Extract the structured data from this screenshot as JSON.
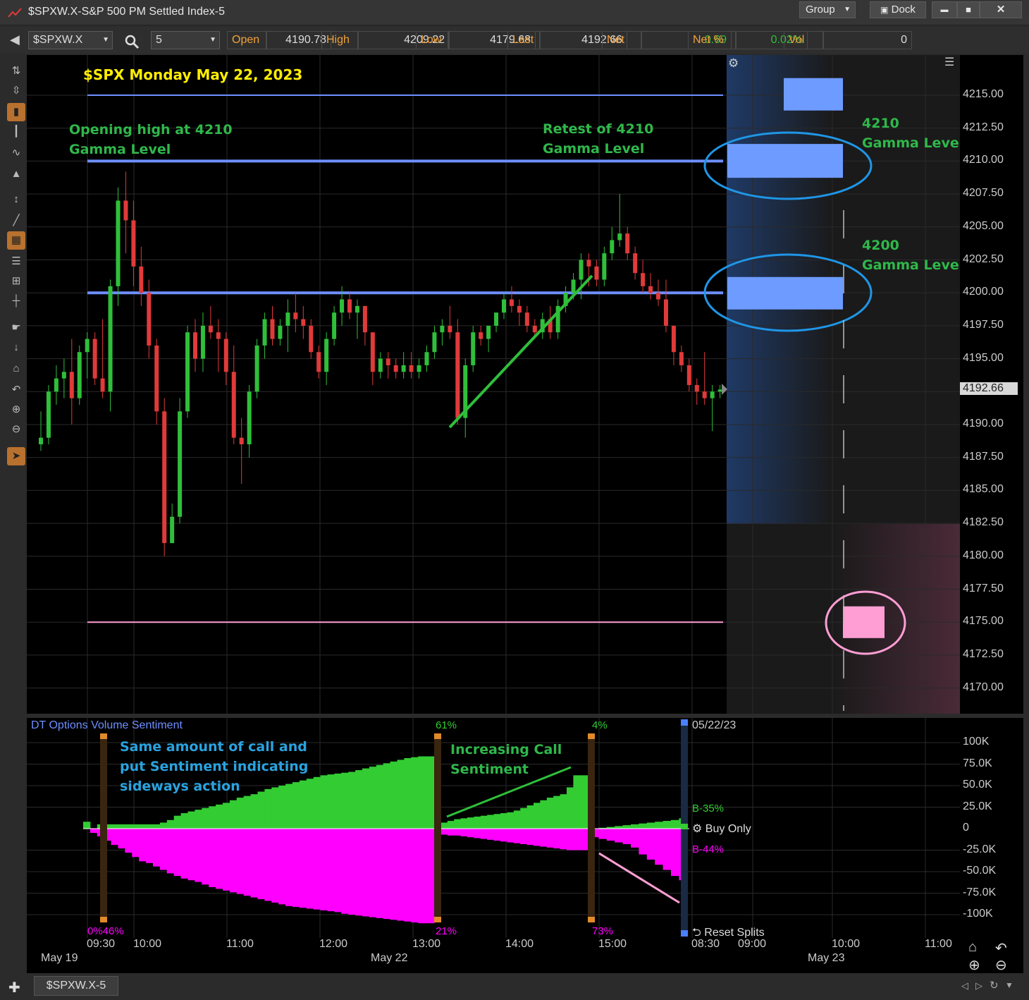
{
  "window": {
    "title": "$SPXW.X-S&P 500 PM Settled Index-5",
    "group_label": "Group",
    "dock_label": "Dock",
    "minimize": "▬",
    "maximize": "■",
    "close": "✕"
  },
  "symbol_bar": {
    "symbol": "$SPXW.X",
    "interval": "5",
    "quote": [
      {
        "label": "Open",
        "value": "4190.78"
      },
      {
        "label": "High",
        "value": "4209.22"
      },
      {
        "label": "Low",
        "value": "4179.68"
      },
      {
        "label": "Last",
        "value": "4192.66"
      },
      {
        "label": "Net",
        "value": "0.69"
      },
      {
        "label": "Net %",
        "value": "0.02%"
      },
      {
        "label": "Vol",
        "value": "0"
      }
    ]
  },
  "price_axis": {
    "labels": [
      "4215.00",
      "4212.50",
      "4210.00",
      "4207.50",
      "4205.00",
      "4202.50",
      "4200.00",
      "4197.50",
      "4195.00",
      "4192.66",
      "4190.00",
      "4187.50",
      "4185.00",
      "4182.50",
      "4180.00",
      "4177.50",
      "4175.00",
      "4172.50",
      "4170.00"
    ],
    "last_price": "4192.66"
  },
  "annotations": {
    "chart_title": "$SPX Monday May 22, 2023",
    "opening_high_line1": "Opening high at 4210",
    "opening_high_line2": "Gamma Level",
    "retest_line1": "Retest of 4210",
    "retest_line2": "Gamma Level",
    "gamma4210_line1": "4210",
    "gamma4210_line2": "Gamma Level",
    "gamma4200_line1": "4200",
    "gamma4200_line2": "Gamma Level",
    "sentiment_line1": "Same amount of call and",
    "sentiment_line2": "put Sentiment indicating",
    "sentiment_line3": "sideways action",
    "increasing_line1": "Increasing Call",
    "increasing_line2": "Sentiment"
  },
  "indicator": {
    "title": "DT Options Volume Sentiment",
    "date": "05/22/23",
    "pct_61": "61%",
    "pct_4": "4%",
    "pct_0_46": "0%46%",
    "pct_21": "21%",
    "pct_73": "73%",
    "b_pos": "B-35%",
    "b_neg": "B-44%",
    "buy_only": "Buy Only",
    "reset_splits": "Reset Splits",
    "axis": [
      "100K",
      "75.0K",
      "50.0K",
      "25.0K",
      "0",
      "-25.0K",
      "-50.0K",
      "-75.0K",
      "-100K"
    ]
  },
  "time_axis": {
    "labels": [
      "09:30",
      "10:00",
      "11:00",
      "12:00",
      "13:00",
      "14:00",
      "15:00",
      "08:30",
      "09:00",
      "10:00",
      "11:00"
    ],
    "dates": [
      "May 19",
      "May 22",
      "May 23"
    ]
  },
  "tab": {
    "label": "$SPXW.X-5"
  },
  "colors": {
    "up": "#2fbf3a",
    "down": "#e03a3a",
    "gamma_line": "#6e8fff",
    "gamma_box": "#6e9bff",
    "put_box": "#ff9ed4",
    "call_fill": "#33cc33",
    "put_fill": "#ff00ff",
    "annotation_green": "#2fb84a",
    "annotation_blue": "#29a3e0",
    "title_yellow": "#ffee00"
  },
  "chart_data": {
    "type": "candlestick",
    "symbol": "$SPXW.X",
    "interval_minutes": 5,
    "y_range": [
      4168,
      4218
    ],
    "y_ticks": [
      4170,
      4172.5,
      4175,
      4177.5,
      4180,
      4182.5,
      4185,
      4187.5,
      4190,
      4192.5,
      4195,
      4197.5,
      4200,
      4202.5,
      4205,
      4207.5,
      4210,
      4212.5,
      4215
    ],
    "horizontal_levels": [
      4215,
      4210,
      4200,
      4175
    ],
    "candles": [
      [
        4188.5,
        4191,
        4188,
        4189
      ],
      [
        4189,
        4193,
        4188.5,
        4192.5
      ],
      [
        4192.5,
        4194.5,
        4191.5,
        4193.5
      ],
      [
        4193.5,
        4195,
        4192,
        4194
      ],
      [
        4194,
        4196.5,
        4190,
        4192
      ],
      [
        4192,
        4196,
        4191.5,
        4195.5
      ],
      [
        4195.5,
        4197,
        4193.5,
        4196.5
      ],
      [
        4196.5,
        4197,
        4193,
        4193.5
      ],
      [
        4193.5,
        4198,
        4192,
        4192.5
      ],
      [
        4192.5,
        4201,
        4191,
        4200.5
      ],
      [
        4200.5,
        4208,
        4199,
        4207
      ],
      [
        4207,
        4209.2,
        4203,
        4205.5
      ],
      [
        4205.5,
        4207,
        4200.5,
        4202
      ],
      [
        4202,
        4203.5,
        4199,
        4200
      ],
      [
        4200,
        4201,
        4195,
        4196
      ],
      [
        4196,
        4196.5,
        4190,
        4191
      ],
      [
        4191,
        4192,
        4180,
        4181
      ],
      [
        4181,
        4184,
        4181,
        4183
      ],
      [
        4183,
        4192,
        4182.5,
        4191
      ],
      [
        4191,
        4197.5,
        4190.5,
        4197
      ],
      [
        4197,
        4198,
        4194,
        4195
      ],
      [
        4195,
        4198.5,
        4194,
        4197.5
      ],
      [
        4197.5,
        4199,
        4196.5,
        4197
      ],
      [
        4197,
        4198,
        4194,
        4196.5
      ],
      [
        4196.5,
        4197,
        4193,
        4194
      ],
      [
        4194,
        4196,
        4188.5,
        4189
      ],
      [
        4189,
        4190.5,
        4185.5,
        4188.5
      ],
      [
        4188.5,
        4193,
        4187.5,
        4192.5
      ],
      [
        4192.5,
        4196.5,
        4192,
        4196
      ],
      [
        4196,
        4198.5,
        4195,
        4198
      ],
      [
        4198,
        4199,
        4196,
        4196.5
      ],
      [
        4196.5,
        4198,
        4196,
        4197.5
      ],
      [
        4197.5,
        4199.5,
        4195.5,
        4198.5
      ],
      [
        4198.5,
        4200,
        4197,
        4198
      ],
      [
        4198,
        4199,
        4196.5,
        4197.5
      ],
      [
        4197.5,
        4198,
        4195,
        4195.5
      ],
      [
        4195.5,
        4196,
        4193.5,
        4194
      ],
      [
        4194,
        4197,
        4193,
        4196.5
      ],
      [
        4196.5,
        4199,
        4196,
        4198.5
      ],
      [
        4198.5,
        4200.5,
        4197.5,
        4199.5
      ],
      [
        4199.5,
        4200,
        4198,
        4198.5
      ],
      [
        4198.5,
        4199.5,
        4196.5,
        4199
      ],
      [
        4199,
        4199,
        4196,
        4197
      ],
      [
        4197,
        4197,
        4193,
        4194
      ],
      [
        4194,
        4195.5,
        4193.5,
        4195
      ],
      [
        4195,
        4195.5,
        4193.5,
        4194.5
      ],
      [
        4194.5,
        4195,
        4193.5,
        4194
      ],
      [
        4194,
        4195.5,
        4193.5,
        4194.5
      ],
      [
        4194.5,
        4195.5,
        4193.5,
        4194
      ],
      [
        4194,
        4195,
        4193.5,
        4194.5
      ],
      [
        4194.5,
        4196,
        4194,
        4195.5
      ],
      [
        4195.5,
        4197.5,
        4195,
        4197
      ],
      [
        4197,
        4198,
        4196,
        4197.5
      ],
      [
        4197.5,
        4199,
        4196.5,
        4197
      ],
      [
        4197,
        4198,
        4190,
        4190.5
      ],
      [
        4190.5,
        4195,
        4189,
        4194.5
      ],
      [
        4194.5,
        4197.5,
        4194,
        4197
      ],
      [
        4197,
        4197.5,
        4196,
        4196.5
      ],
      [
        4196.5,
        4197.5,
        4195.5,
        4197.5
      ],
      [
        4197.5,
        4198.5,
        4197,
        4198.5
      ],
      [
        4198.5,
        4200,
        4198,
        4199.5
      ],
      [
        4199.5,
        4200.5,
        4198.5,
        4199
      ],
      [
        4199,
        4199.5,
        4197.5,
        4198.5
      ],
      [
        4198.5,
        4199,
        4197,
        4197.5
      ],
      [
        4197.5,
        4198,
        4196.5,
        4197
      ],
      [
        4197,
        4198.5,
        4196.5,
        4198
      ],
      [
        4198,
        4199,
        4196.5,
        4197
      ],
      [
        4197,
        4199.5,
        4196.5,
        4199
      ],
      [
        4199,
        4200.5,
        4198.5,
        4200
      ],
      [
        4200,
        4201.5,
        4199.5,
        4201
      ],
      [
        4201,
        4203,
        4199.5,
        4202.5
      ],
      [
        4202.5,
        4203,
        4200.5,
        4202
      ],
      [
        4202,
        4202.5,
        4200.5,
        4201
      ],
      [
        4201,
        4203.5,
        4200.5,
        4203
      ],
      [
        4203,
        4205,
        4202.5,
        4204
      ],
      [
        4204,
        4207.5,
        4203.5,
        4204.5
      ],
      [
        4204.5,
        4205,
        4202.5,
        4203
      ],
      [
        4203,
        4203.5,
        4201,
        4201.5
      ],
      [
        4201.5,
        4202.5,
        4200,
        4200.5
      ],
      [
        4200.5,
        4201.5,
        4199.5,
        4200
      ],
      [
        4200,
        4201,
        4199,
        4199.5
      ],
      [
        4199.5,
        4201,
        4197,
        4197.5
      ],
      [
        4197.5,
        4197.5,
        4194.5,
        4195.5
      ],
      [
        4195.5,
        4196,
        4194,
        4194.5
      ],
      [
        4194.5,
        4195,
        4192.5,
        4193
      ],
      [
        4193,
        4193.5,
        4191.5,
        4192.5
      ],
      [
        4192.5,
        4195.5,
        4191.5,
        4192
      ],
      [
        4192,
        4193,
        4189.5,
        4192.5
      ],
      [
        4192.5,
        4193,
        4192,
        4192.66
      ]
    ],
    "indicator": {
      "name": "DT Options Volume Sentiment",
      "y_range": [
        -110000,
        110000
      ],
      "calls_K": [
        8,
        0,
        5,
        5,
        5,
        5,
        5,
        5,
        5,
        5,
        5,
        7,
        10,
        15,
        18,
        20,
        22,
        24,
        26,
        28,
        30,
        33,
        36,
        38,
        40,
        43,
        46,
        48,
        50,
        52,
        54,
        56,
        58,
        60,
        62,
        63,
        64,
        65,
        66,
        68,
        70,
        72,
        74,
        76,
        78,
        80,
        82,
        83,
        84,
        5,
        7,
        9,
        11,
        12,
        13,
        14,
        15,
        16,
        17,
        18,
        19,
        21,
        24,
        27,
        30,
        33,
        36,
        38,
        40,
        48,
        62,
        0,
        1,
        2,
        3,
        4,
        5,
        6,
        7,
        8,
        9,
        10,
        12
      ],
      "puts_K": [
        0,
        -5,
        -9,
        -14,
        -19,
        -23,
        -28,
        -33,
        -38,
        -40,
        -44,
        -48,
        -52,
        -55,
        -58,
        -60,
        -62,
        -65,
        -68,
        -70,
        -72,
        -74,
        -76,
        -78,
        -80,
        -82,
        -84,
        -86,
        -88,
        -90,
        -91,
        -92,
        -93,
        -94,
        -95,
        -96,
        -97,
        -99,
        -100,
        -101,
        -102,
        -103,
        -104,
        -105,
        -106,
        -107,
        -108,
        -109,
        -110,
        -6,
        -7,
        -8,
        -8,
        -9,
        -10,
        -11,
        -12,
        -13,
        -14,
        -15,
        -16,
        -17,
        -18,
        -19,
        -20,
        -21,
        -22,
        -23,
        -24,
        -25,
        -25,
        -10,
        -12,
        -14,
        -16,
        -18,
        -22,
        -30,
        -36,
        -42,
        -48,
        -55,
        -60
      ],
      "markers": [
        "0%46%",
        "61%",
        "21%",
        "4%",
        "73%",
        "B-35%",
        "B-44%"
      ]
    }
  }
}
